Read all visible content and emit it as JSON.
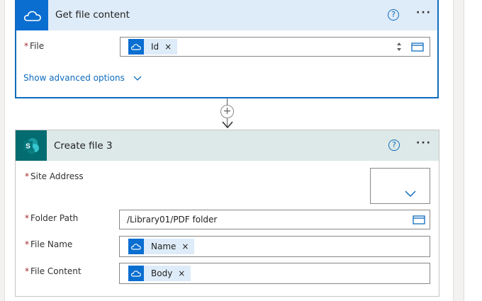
{
  "card1": {
    "title": "Get file content",
    "help_icon": "?",
    "more_icon": "···",
    "field_label": "File",
    "required_mark": "*",
    "token_label": "Id",
    "token_remove": "×",
    "advanced_link": "Show advanced options",
    "advanced_chevron": "chevron-down-icon"
  },
  "connector": {
    "plus": "+"
  },
  "card2": {
    "title": "Create file 3",
    "help_icon": "?",
    "more_icon": "···",
    "site_address_label": "Site Address",
    "folder_path_label": "Folder Path",
    "folder_path_value": "/Library01/PDF folder",
    "file_name_label": "File Name",
    "file_name_token": "Name",
    "file_content_label": "File Content",
    "file_content_token": "Body",
    "token_remove": "×",
    "required_mark": "*"
  },
  "colors": {
    "accent": "#0f6cbd",
    "onedrive_icon_bg": "#0a6ed1",
    "sharepoint_icon_bg": "#036c70",
    "card1_header": "#deebf8",
    "card2_header": "#dce9e8",
    "required": "#a4262c"
  }
}
